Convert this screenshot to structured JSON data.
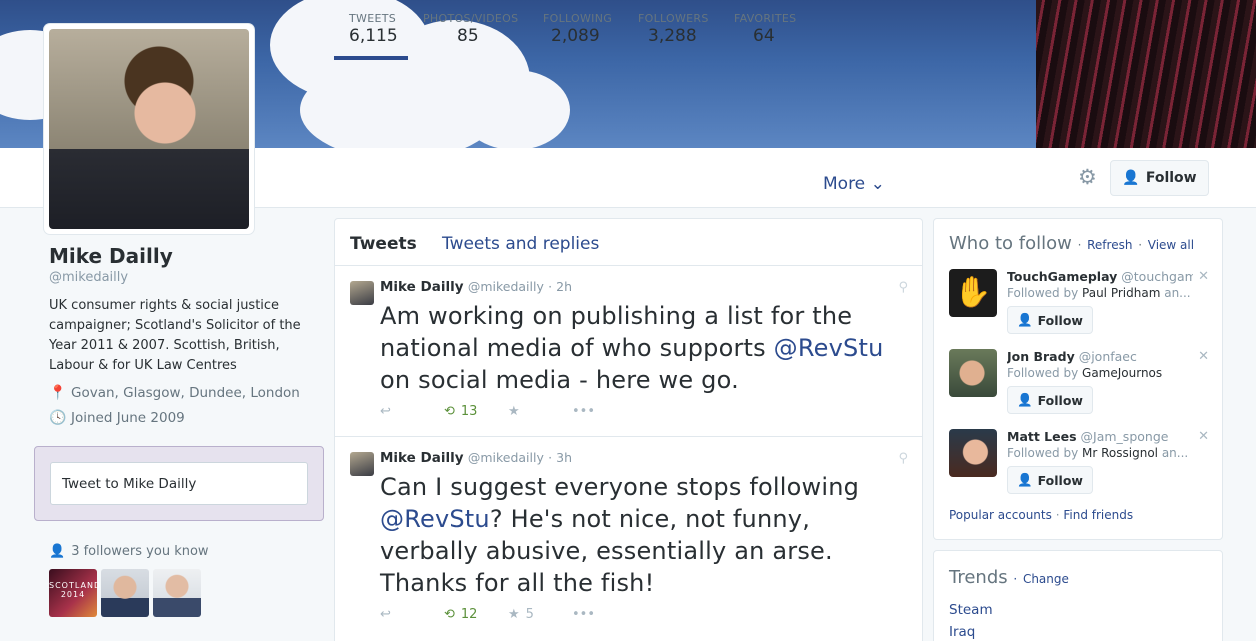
{
  "profile": {
    "name": "Mike Dailly",
    "handle": "@mikedailly",
    "bio": "UK consumer rights & social justice campaigner; Scotland's Solicitor of the Year 2011 & 2007. Scottish, British, Labour & for UK Law Centres",
    "location": "Govan, Glasgow, Dundee, London",
    "joined": "Joined June 2009",
    "tweet_to_placeholder": "Tweet to Mike Dailly",
    "followers_you_know": "3 followers you know"
  },
  "stats": [
    {
      "label": "TWEETS",
      "value": "6,115"
    },
    {
      "label": "PHOTOS/VIDEOS",
      "value": "85"
    },
    {
      "label": "FOLLOWING",
      "value": "2,089"
    },
    {
      "label": "FOLLOWERS",
      "value": "3,288"
    },
    {
      "label": "FAVORITES",
      "value": "64"
    }
  ],
  "nav": {
    "more": "More",
    "follow": "Follow"
  },
  "timeline": {
    "tabs": [
      "Tweets",
      "Tweets and replies"
    ],
    "tweets": [
      {
        "name": "Mike Dailly",
        "handle": "@mikedailly",
        "time": "· 2h",
        "text_1": "Am working on publishing a list for the national media of who supports ",
        "mention": "@RevStu",
        "text_2": " on social media - here we go.",
        "retweets": "13",
        "favorites": ""
      },
      {
        "name": "Mike Dailly",
        "handle": "@mikedailly",
        "time": "· 3h",
        "text_1": "Can I suggest everyone stops following ",
        "mention": "@RevStu",
        "text_2": "? He's not nice, not funny, verbally abusive, essentially an arse. Thanks for all the fish!",
        "retweets": "12",
        "favorites": "5"
      }
    ]
  },
  "who_to_follow": {
    "title": "Who to follow",
    "refresh": "Refresh",
    "view_all": "View all",
    "suggestions": [
      {
        "name": "TouchGameplay",
        "handle": "@touchgam...",
        "followed_by_prefix": "Followed by",
        "followed_by": "Paul Pridham",
        "followed_by_suffix": "an...",
        "button": "Follow"
      },
      {
        "name": "Jon Brady",
        "handle": "@jonfaec",
        "followed_by_prefix": "Followed by",
        "followed_by": "GameJournos",
        "followed_by_suffix": "",
        "button": "Follow"
      },
      {
        "name": "Matt Lees",
        "handle": "@Jam_sponge",
        "followed_by_prefix": "Followed by",
        "followed_by": "Mr Rossignol",
        "followed_by_suffix": "an...",
        "button": "Follow"
      }
    ],
    "popular": "Popular accounts",
    "find_friends": "Find friends"
  },
  "trends": {
    "title": "Trends",
    "change": "Change",
    "items": [
      "Steam",
      "Iraq"
    ]
  },
  "thumbs": {
    "scotland_text": "SCOTLAND 2014"
  },
  "colors": {
    "accent": "#2c4b8e",
    "retweet": "#5c913b",
    "follow_plus": "#3b94d9",
    "tweet_box_bg": "#e6e2ee"
  }
}
